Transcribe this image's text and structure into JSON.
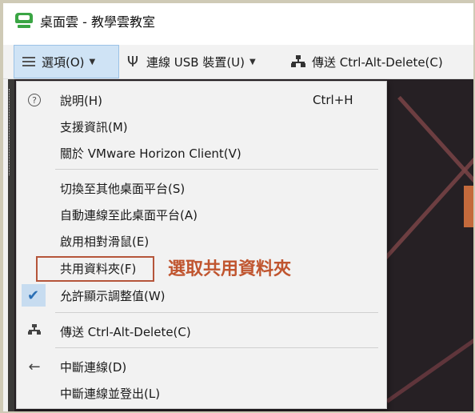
{
  "window": {
    "title": "桌面雲 - 教學雲教室"
  },
  "toolbar": {
    "options_label": "選項(O)",
    "usb_label": "連線 USB 裝置(U)",
    "send_cad_label": "傳送 Ctrl-Alt-Delete(C)"
  },
  "menu": {
    "help": {
      "label": "說明(H)",
      "shortcut": "Ctrl+H",
      "icon": "help-circle-icon"
    },
    "support": {
      "label": "支援資訊(M)"
    },
    "about": {
      "label": "關於 VMware Horizon Client(V)"
    },
    "switch_desktop": {
      "label": "切換至其他桌面平台(S)"
    },
    "autoconnect": {
      "label": "自動連線至此桌面平台(A)"
    },
    "relative_mouse": {
      "label": "啟用相對滑鼠(E)"
    },
    "share_folders": {
      "label": "共用資料夾(F)"
    },
    "allow_scaling": {
      "label": "允許顯示調整值(W)",
      "checked": true,
      "icon": "checkmark-icon"
    },
    "send_cad": {
      "label": "傳送 Ctrl-Alt-Delete(C)",
      "icon": "network-icon"
    },
    "disconnect": {
      "label": "中斷連線(D)",
      "icon": "arrow-left-icon"
    },
    "disconnect_logoff": {
      "label": "中斷連線並登出(L)"
    }
  },
  "annotation": {
    "text": "選取共用資料夾",
    "color": "#c0552f"
  },
  "colors": {
    "app_green": "#3aa544",
    "toolbar_selected": "#cfe3f5",
    "menu_bg": "#f2f2f2"
  }
}
